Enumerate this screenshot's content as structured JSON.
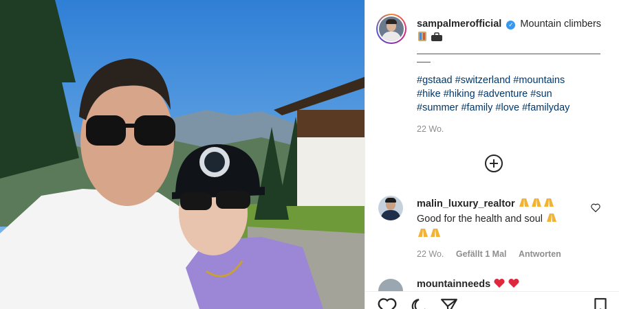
{
  "post": {
    "username": "sampalmerofficial",
    "verified_mark": "✓",
    "caption_text": "Mountain climbers",
    "caption_emojis": [
      "climber-emoji",
      "briefcase-emoji"
    ],
    "hashtag_lines": [
      "#gstaad #switzerland #mountains",
      "#hike #hiking #adventure #sun",
      "#summer #family #love #familyday"
    ],
    "time": "22 Wo.",
    "accent_link": "#00376b",
    "verified_color": "#3897f0"
  },
  "comment": {
    "username": "malin_luxury_realtor",
    "text": "Good for the health and soul",
    "time": "22 Wo.",
    "likes": "Gefällt 1 Mal",
    "reply": "Antworten"
  },
  "next_comment": {
    "username": "mountainneeds"
  },
  "icons": {
    "add_comments": "plus-circle-icon",
    "like": "heart-icon",
    "comment": "comment-icon",
    "share": "share-icon",
    "save": "bookmark-icon"
  }
}
